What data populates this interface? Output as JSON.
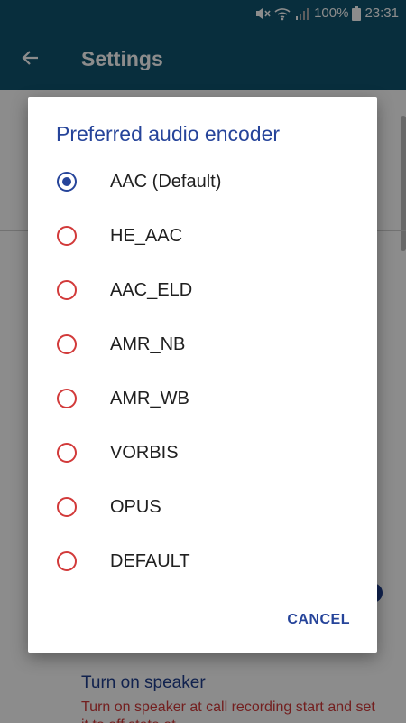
{
  "status_bar": {
    "battery_percent": "100%",
    "time": "23:31",
    "icons": [
      "mute-icon",
      "wifi-icon",
      "signal-icon",
      "battery-icon"
    ]
  },
  "app_bar": {
    "title": "Settings",
    "back_icon": "arrow-back-icon"
  },
  "background": {
    "pref_title": "Turn on speaker",
    "pref_summary": "Turn on speaker at call recording start and set it to off state at"
  },
  "dialog": {
    "title": "Preferred audio encoder",
    "selected_index": 0,
    "options": [
      {
        "label": "AAC (Default)"
      },
      {
        "label": "HE_AAC"
      },
      {
        "label": "AAC_ELD"
      },
      {
        "label": "AMR_NB"
      },
      {
        "label": "AMR_WB"
      },
      {
        "label": "VORBIS"
      },
      {
        "label": "OPUS"
      },
      {
        "label": "DEFAULT"
      }
    ],
    "cancel_label": "CANCEL"
  },
  "colors": {
    "app_bar": "#0f5570",
    "accent": "#26449a",
    "radio_unchecked": "#d23a3a",
    "summary_text": "#d23a3a"
  }
}
